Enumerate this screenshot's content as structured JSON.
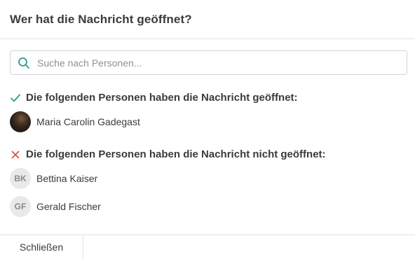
{
  "dialog": {
    "title": "Wer hat die Nachricht geöffnet?"
  },
  "search": {
    "placeholder": "Suche nach Personen...",
    "value": "",
    "icon": "search-icon"
  },
  "opened": {
    "heading": "Die folgenden Personen haben die Nachricht geöffnet:",
    "icon": "check-icon",
    "color": "#2a9d8f",
    "people": [
      {
        "name": "Maria Carolin Gadegast",
        "avatar": "photo"
      }
    ]
  },
  "not_opened": {
    "heading": "Die folgenden Personen haben die Nachricht nicht geöffnet:",
    "icon": "cross-icon",
    "color": "#e2483d",
    "people": [
      {
        "name": "Bettina Kaiser",
        "initials": "BK"
      },
      {
        "name": "Gerald Fischer",
        "initials": "GF"
      }
    ]
  },
  "footer": {
    "close_label": "Schließen"
  },
  "colors": {
    "accent": "#2a9d8f",
    "danger": "#e2483d",
    "border": "#e3e3e3",
    "text": "#3b3b3b"
  }
}
